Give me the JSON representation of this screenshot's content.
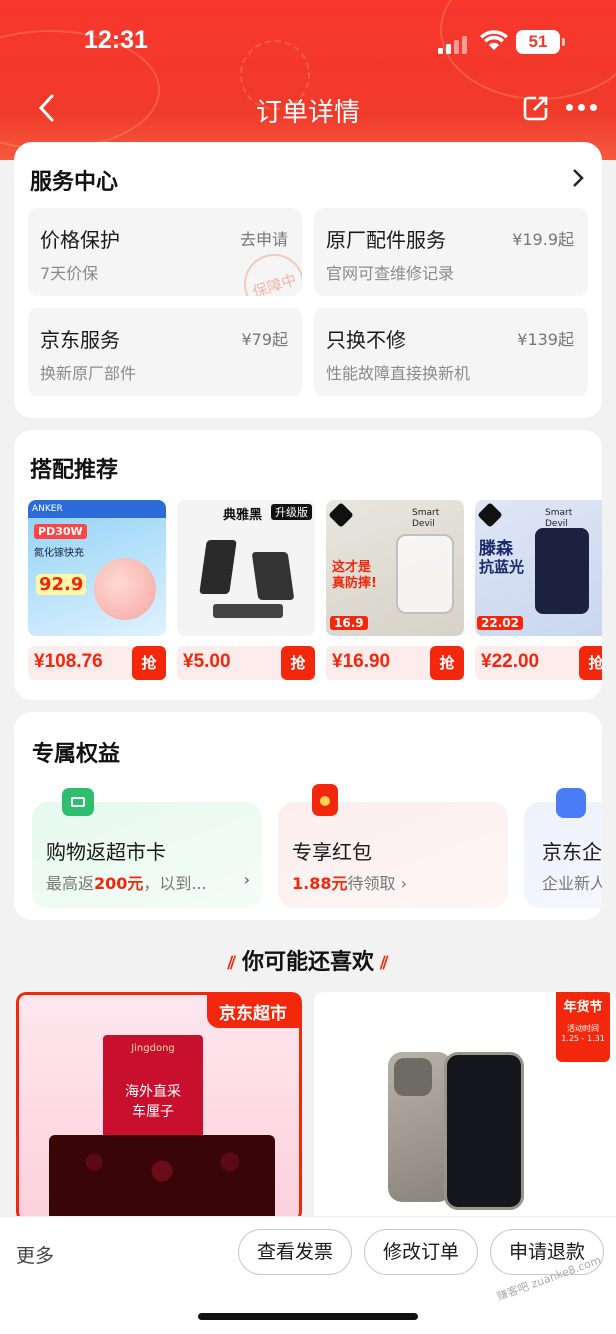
{
  "status_bar": {
    "time": "12:31",
    "battery": "51"
  },
  "nav": {
    "title": "订单详情"
  },
  "service_center": {
    "title": "服务中心",
    "stamp": "保障中",
    "items": [
      {
        "name": "价格保护",
        "price": "去申请",
        "desc": "7天价保"
      },
      {
        "name": "原厂配件服务",
        "price": "¥19.9起",
        "desc": "官网可查维修记录"
      },
      {
        "name": "京东服务",
        "price": "¥79起",
        "desc": "换新原厂部件"
      },
      {
        "name": "只换不修",
        "price": "¥139起",
        "desc": "性能故障直接换新机"
      }
    ]
  },
  "recommend": {
    "title": "搭配推荐",
    "grab": "抢",
    "products": [
      {
        "price": "¥108.76",
        "img_text1": "PD30W",
        "img_text2": "氮化镓快充",
        "img_text3": "92.9",
        "brand": "ANKER"
      },
      {
        "price": "¥5.00",
        "img_text1": "典雅黑",
        "img_text2": "升级版"
      },
      {
        "price": "¥16.90",
        "img_text1": "这才是",
        "img_text2": "真防摔!",
        "img_text3": "16.9",
        "brand": "Smart Devil"
      },
      {
        "price": "¥22.00",
        "img_text1": "滕森",
        "img_text2": "抗蓝光",
        "img_text3": "22.02",
        "brand": "Smart Devil"
      }
    ]
  },
  "benefits": {
    "title": "专属权益",
    "items": [
      {
        "title": "购物返超市卡",
        "desc_prefix": "最高返",
        "desc_highlight": "200元",
        "desc_suffix": "，以到...",
        "color": "#2ebf6e"
      },
      {
        "title": "专享红包",
        "desc_prefix": "",
        "desc_highlight": "1.88元",
        "desc_suffix": "待领取",
        "color": "#f2270c"
      },
      {
        "title": "京东企",
        "desc_prefix": "企业新人",
        "desc_highlight": "",
        "desc_suffix": "",
        "color": "#4a7cf7"
      }
    ]
  },
  "guess": {
    "title": "你可能还喜欢",
    "cards": [
      {
        "badge": "京东超市",
        "banner1": "海外直采",
        "banner2": "车厘子",
        "note": "Jingdong"
      },
      {
        "badge": "年货节",
        "badge2": "活动时间",
        "badge3": "1.25 - 1.31"
      }
    ]
  },
  "bottom_bar": {
    "more": "更多",
    "buttons": [
      "查看发票",
      "修改订单",
      "申请退款"
    ]
  },
  "watermark": "赚客吧 zuanke8.com"
}
